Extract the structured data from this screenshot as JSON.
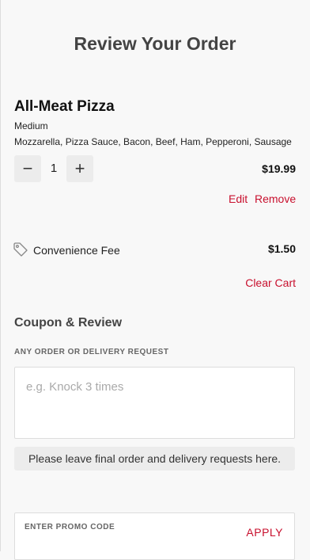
{
  "header": {
    "title": "Review Your Order"
  },
  "cart_item": {
    "name": "All-Meat Pizza",
    "size": "Medium",
    "toppings": "Mozzarella, Pizza Sauce, Bacon, Beef, Ham, Pepperoni, Sausage",
    "quantity": "1",
    "price": "$19.99",
    "minus_symbol": "−",
    "plus_symbol": "+",
    "edit_label": "Edit",
    "remove_label": "Remove"
  },
  "fee": {
    "label": "Convenience Fee",
    "price": "$1.50",
    "icon": "tag-icon"
  },
  "cart_actions": {
    "clear_label": "Clear Cart"
  },
  "coupon_section": {
    "title": "Coupon & Review",
    "request_label": "ANY ORDER OR DELIVERY REQUEST",
    "request_placeholder": "e.g. Knock 3 times",
    "note": "Please leave final order and delivery requests here.",
    "promo_placeholder": "ENTER PROMO CODE",
    "apply_label": "APPLY"
  },
  "colors": {
    "accent": "#c8102e",
    "background": "#f8f8f8",
    "button_bg": "#ececec"
  }
}
